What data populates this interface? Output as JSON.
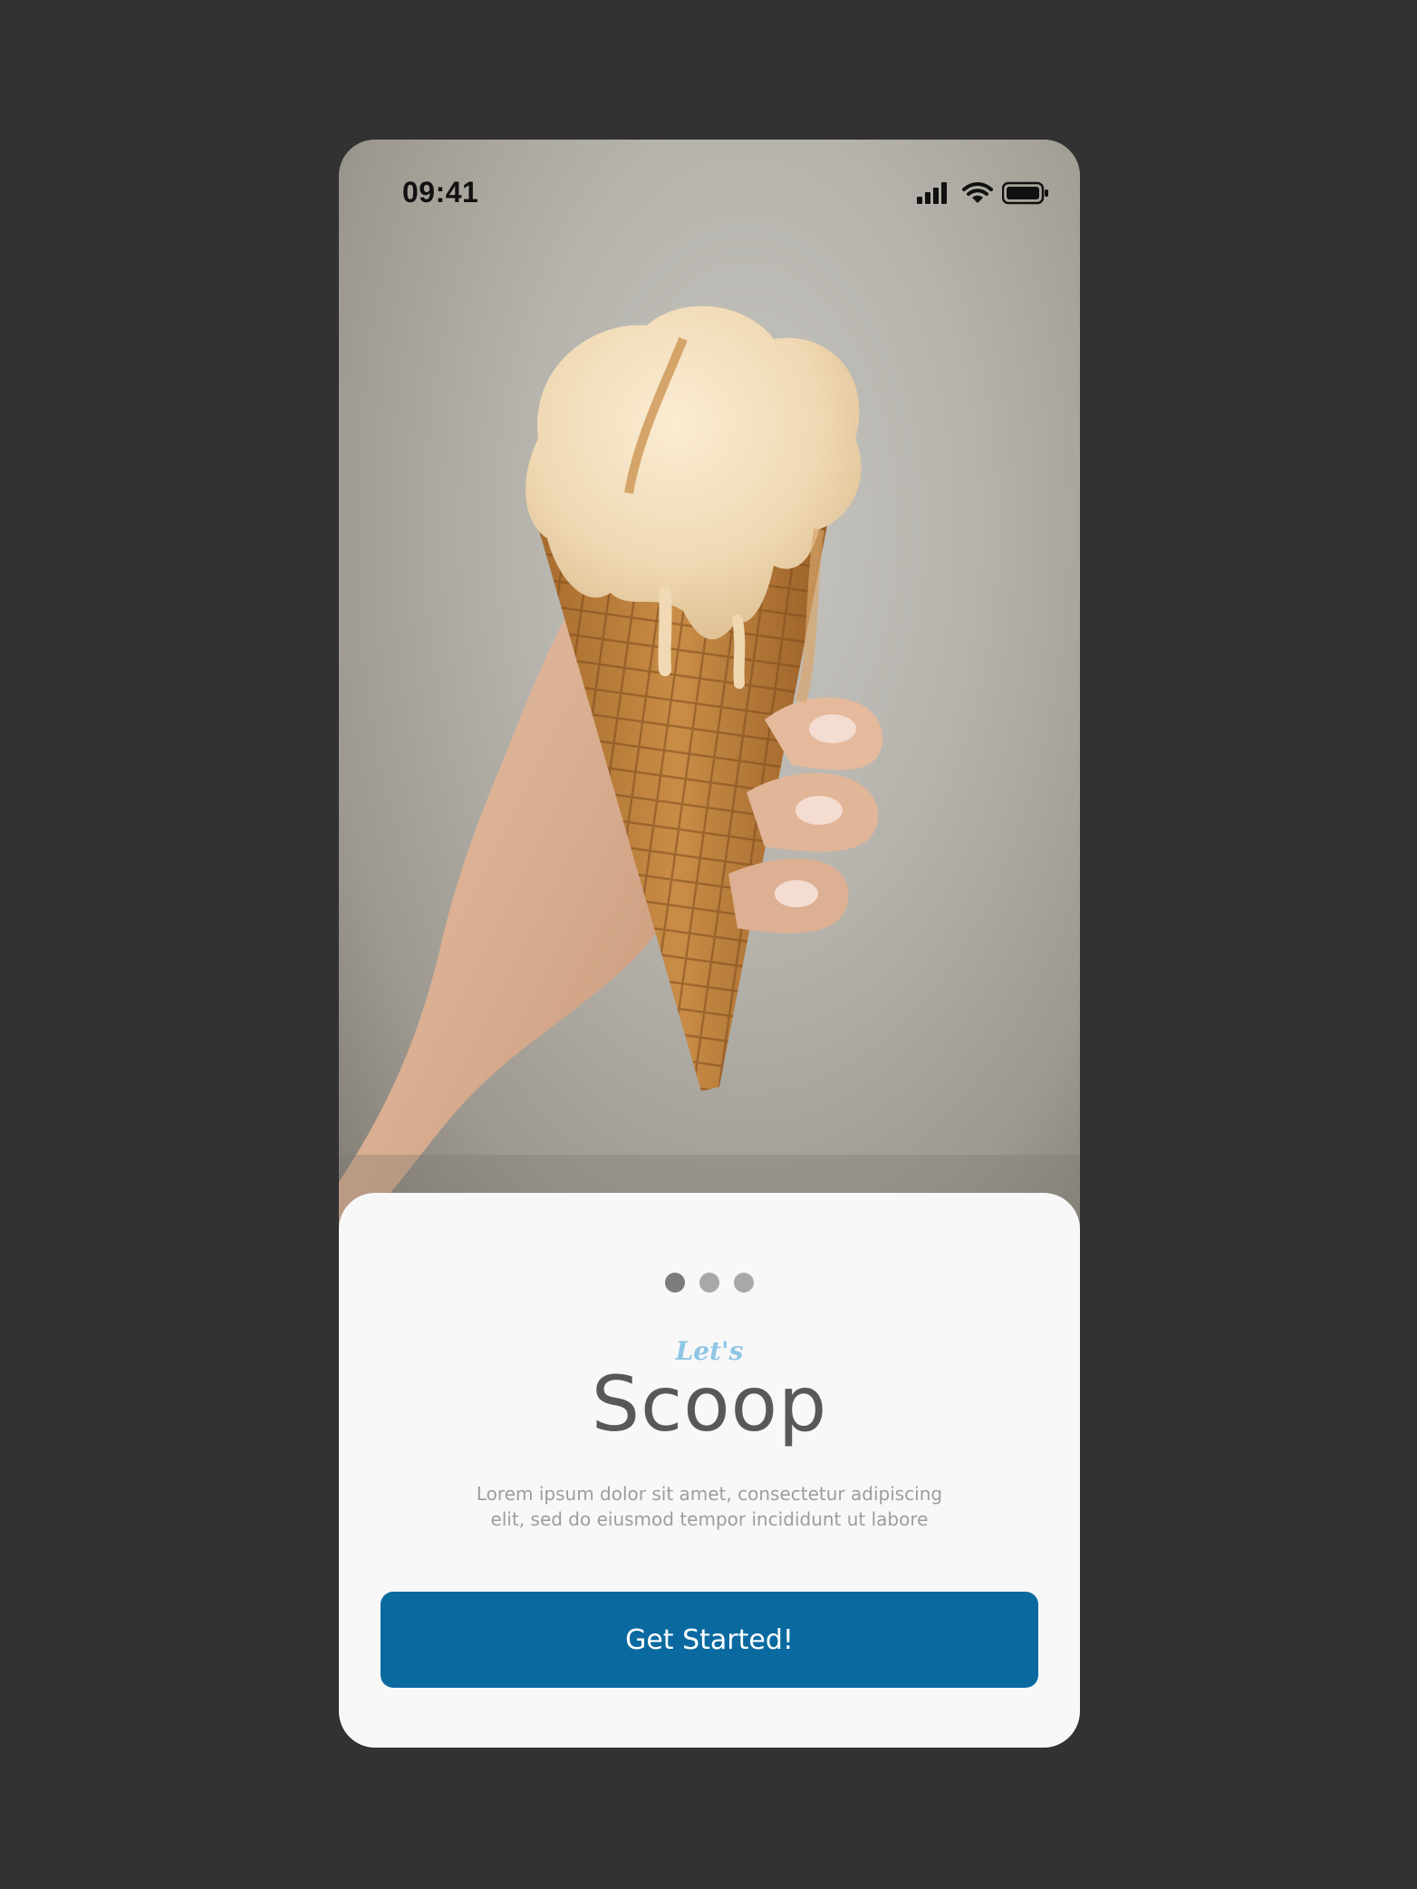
{
  "status_bar": {
    "time": "09:41",
    "icons": [
      "signal-icon",
      "wifi-icon",
      "battery-icon"
    ]
  },
  "hero": {
    "image_subject": "hand-holding-ice-cream-cone"
  },
  "pager": {
    "count": 3,
    "active_index": 0
  },
  "onboarding": {
    "kicker": "Let's",
    "title": "Scoop",
    "description_line1": "Lorem ipsum dolor sit amet, consectetur adipiscing",
    "description_line2": "elit, sed do eiusmod tempor incididunt ut labore",
    "cta_label": "Get Started!"
  },
  "colors": {
    "background": "#323232",
    "sheet": "#f8f8f8",
    "accent": "#0a6aa0",
    "kicker": "#8fc6e6",
    "title": "#585858",
    "description": "#9d9d9d"
  }
}
